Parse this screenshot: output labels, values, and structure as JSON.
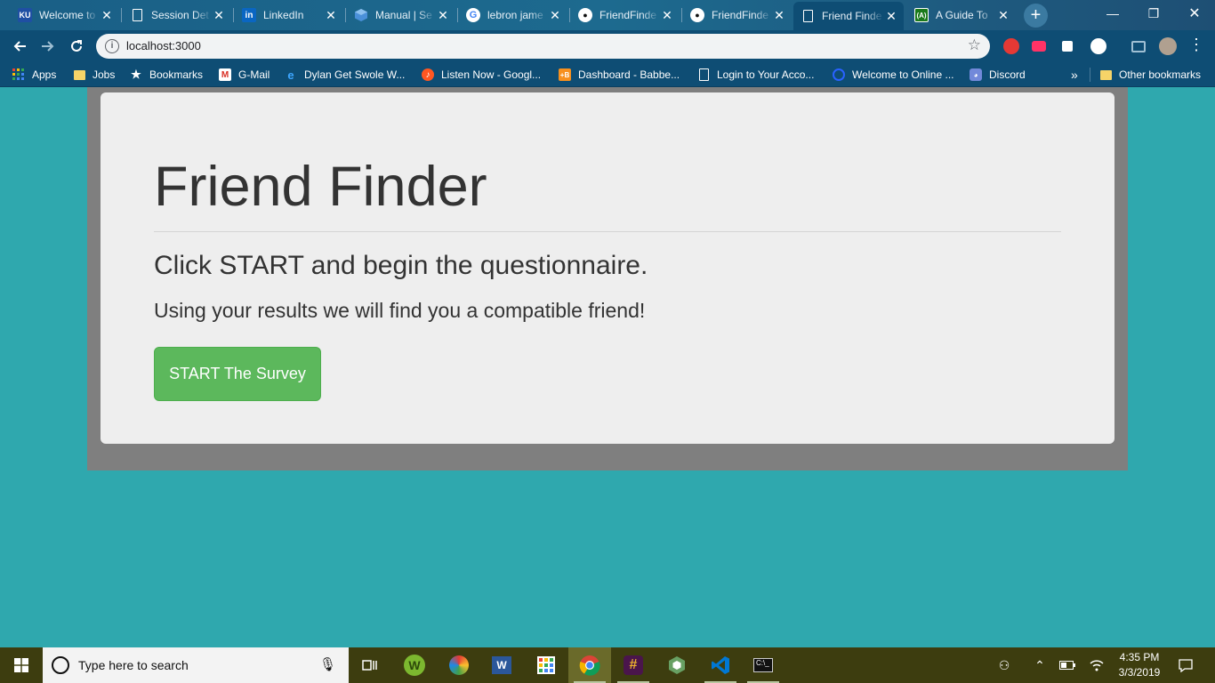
{
  "browser": {
    "tabs": [
      {
        "title": "Welcome to",
        "favicon": "ku-icon",
        "active": false
      },
      {
        "title": "Session Det",
        "favicon": "document-icon",
        "active": false
      },
      {
        "title": "LinkedIn",
        "favicon": "linkedin-icon",
        "active": false
      },
      {
        "title": "Manual | Se",
        "favicon": "cube-icon",
        "active": false
      },
      {
        "title": "lebron jame",
        "favicon": "google-icon",
        "active": false
      },
      {
        "title": "FriendFinde",
        "favicon": "github-icon",
        "active": false
      },
      {
        "title": "FriendFinde",
        "favicon": "github-icon",
        "active": false
      },
      {
        "title": "Friend Finde",
        "favicon": "document-icon",
        "active": true
      },
      {
        "title": "A Guide To",
        "favicon": "codecademy-icon",
        "active": false
      }
    ],
    "address_url": "localhost:3000",
    "bookmarks": [
      {
        "label": "Apps",
        "icon": "apps-grid-icon"
      },
      {
        "label": "Jobs",
        "icon": "folder-icon"
      },
      {
        "label": "Bookmarks",
        "icon": "star-icon"
      },
      {
        "label": "G-Mail",
        "icon": "gmail-icon"
      },
      {
        "label": "Dylan Get Swole W...",
        "icon": "edge-icon"
      },
      {
        "label": "Listen Now - Googl...",
        "icon": "music-icon"
      },
      {
        "label": "Dashboard - Babbe...",
        "icon": "babbel-icon"
      },
      {
        "label": "Login to Your Acco...",
        "icon": "document-icon"
      },
      {
        "label": "Welcome to Online ...",
        "icon": "ring-icon"
      },
      {
        "label": "Discord",
        "icon": "discord-icon"
      }
    ],
    "bookmarks_overflow": "»",
    "other_bookmarks": "Other bookmarks"
  },
  "page": {
    "title": "Friend Finder",
    "lead": "Click START and begin the questionnaire.",
    "subtitle": "Using your results we will find you a compatible friend!",
    "start_button": "START The Survey"
  },
  "taskbar": {
    "search_placeholder": "Type here to search",
    "time": "4:35 PM",
    "date": "3/3/2019"
  },
  "colors": {
    "page_background": "#2fa8ae",
    "container": "#7f7f7f",
    "jumbotron": "#eeeeee",
    "button": "#5cb85c",
    "browser_frame": "#0e4d74",
    "taskbar": "#3d3d0f"
  }
}
